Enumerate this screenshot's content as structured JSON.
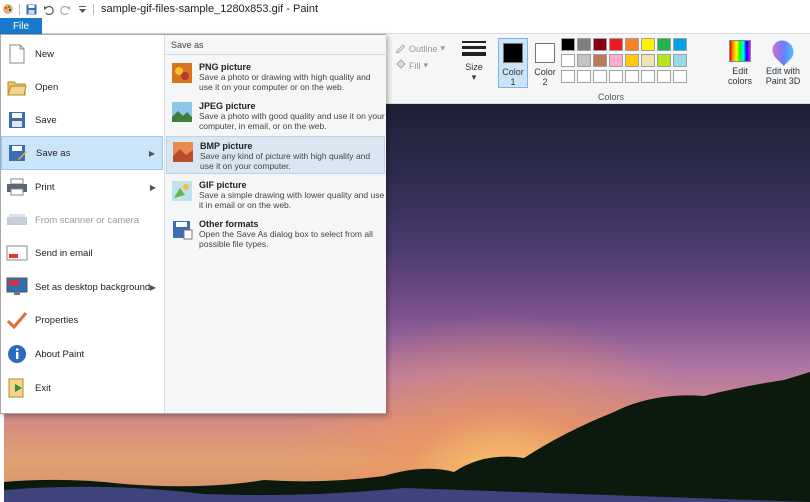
{
  "titlebar": {
    "title": "sample-gif-files-sample_1280x853.gif - Paint",
    "icons": [
      "paint-app-icon",
      "save-icon",
      "undo-icon",
      "redo-icon",
      "customize-icon"
    ]
  },
  "file_tab": {
    "label": "File"
  },
  "ribbon": {
    "shapes": {
      "outline_label": "Outline",
      "fill_label": "Fill"
    },
    "size_label": "Size",
    "color1_label": "Color\n1",
    "color2_label": "Color\n2",
    "color1_value": "#000000",
    "color2_value": "#ffffff",
    "colors_group_label": "Colors",
    "palette_row1": [
      "#000000",
      "#7f7f7f",
      "#880015",
      "#ed1c24",
      "#ff7f27",
      "#fff200",
      "#22b14c",
      "#00a2e8",
      "#3f48cc",
      "#a349a4"
    ],
    "palette_row2": [
      "#ffffff",
      "#c3c3c3",
      "#b97a57",
      "#ffaec9",
      "#ffc90e",
      "#efe4b0",
      "#b5e61d",
      "#99d9ea",
      "#7092be",
      "#c8bfe7"
    ],
    "palette_row3": [
      "#ffffff",
      "#ffffff",
      "#ffffff",
      "#ffffff",
      "#ffffff",
      "#ffffff",
      "#ffffff",
      "#ffffff",
      "#ffffff",
      "#ffffff"
    ],
    "edit_colors_label": "Edit\ncolors",
    "edit_paint3d_label": "Edit with\nPaint 3D"
  },
  "file_menu": {
    "items": [
      {
        "label": "New",
        "icon": "new-file-icon"
      },
      {
        "label": "Open",
        "icon": "open-folder-icon"
      },
      {
        "label": "Save",
        "icon": "save-icon"
      },
      {
        "label": "Save as",
        "icon": "save-as-icon",
        "submenu": true,
        "active": true
      },
      {
        "label": "Print",
        "icon": "printer-icon",
        "submenu": true
      },
      {
        "label": "From scanner or camera",
        "icon": "scanner-icon",
        "disabled": true
      },
      {
        "label": "Send in email",
        "icon": "email-icon"
      },
      {
        "label": "Set as desktop background",
        "icon": "desktop-icon",
        "submenu": true
      },
      {
        "label": "Properties",
        "icon": "checkmark-icon"
      },
      {
        "label": "About Paint",
        "icon": "info-icon"
      },
      {
        "label": "Exit",
        "icon": "exit-icon"
      }
    ]
  },
  "save_as": {
    "header": "Save as",
    "options": [
      {
        "title": "PNG picture",
        "desc": "Save a photo or drawing with high quality and use it on your computer or on the web.",
        "icon": "png-icon"
      },
      {
        "title": "JPEG picture",
        "desc": "Save a photo with good quality and use it on your computer, in email, or on the web.",
        "icon": "jpeg-icon"
      },
      {
        "title": "BMP picture",
        "desc": "Save any kind of picture with high quality and use it on your computer.",
        "icon": "bmp-icon",
        "active": true
      },
      {
        "title": "GIF picture",
        "desc": "Save a simple drawing with lower quality and use it in email or on the web.",
        "icon": "gif-icon"
      },
      {
        "title": "Other formats",
        "desc": "Open the Save As dialog box to select from all possible file types.",
        "icon": "other-formats-icon"
      }
    ]
  }
}
